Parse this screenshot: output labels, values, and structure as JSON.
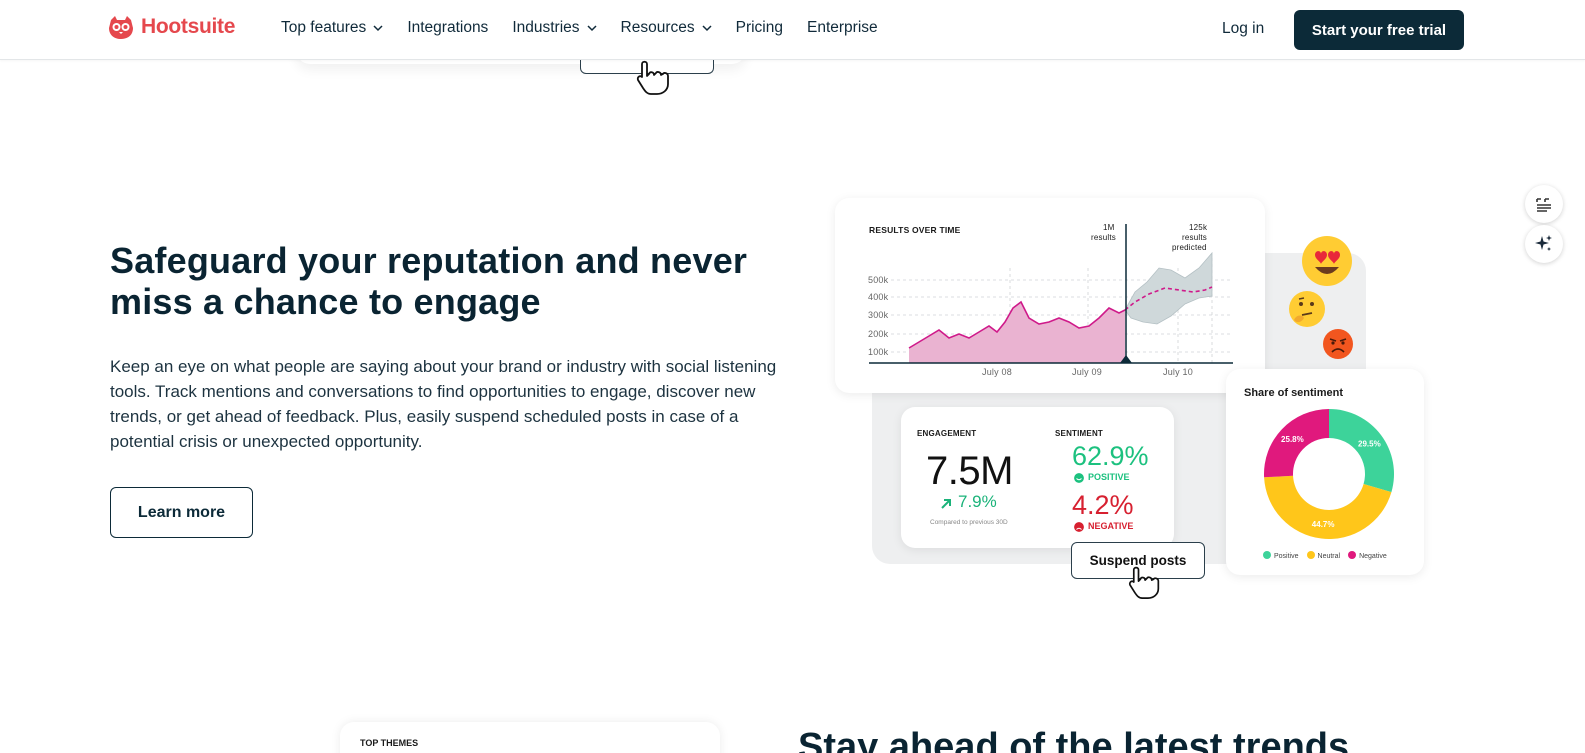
{
  "nav": {
    "logo_text": "Hootsuite",
    "items": [
      {
        "label": "Top features",
        "has_dropdown": true
      },
      {
        "label": "Integrations",
        "has_dropdown": false
      },
      {
        "label": "Industries",
        "has_dropdown": true
      },
      {
        "label": "Resources",
        "has_dropdown": true
      },
      {
        "label": "Pricing",
        "has_dropdown": false
      },
      {
        "label": "Enterprise",
        "has_dropdown": false
      }
    ],
    "login_label": "Log in",
    "cta_label": "Start your free trial"
  },
  "hero": {
    "headline": "Safeguard your reputation and never miss a chance to engage",
    "body": "Keep an eye on what people are saying about your brand or industry with social listening tools. Track mentions and conversations to find opportunities to engage, discover new trends, or get ahead of feedback. Plus, easily suspend scheduled posts in case of a potential crisis or unexpected opportunity.",
    "learn_more_label": "Learn more"
  },
  "results_card": {
    "title": "RESULTS OVER TIME",
    "marker_value": "1M",
    "marker_label": "results",
    "predicted_value": "125k",
    "predicted_label_1": "results",
    "predicted_label_2": "predicted",
    "y_ticks": [
      "500k",
      "400k",
      "300k",
      "200k",
      "100k"
    ],
    "x_ticks": [
      "July 08",
      "July 09",
      "July 10"
    ]
  },
  "engagement_card": {
    "engagement_label": "ENGAGEMENT",
    "engagement_value": "7.5M",
    "engagement_change": "7.9%",
    "engagement_note": "Compared to previous 30D",
    "sentiment_label": "SENTIMENT",
    "positive_value": "62.9%",
    "positive_label": "POSITIVE",
    "negative_value": "4.2%",
    "negative_label": "NEGATIVE"
  },
  "suspend_label": "Suspend posts",
  "sentiment_card": {
    "title": "Share of sentiment",
    "slices": [
      {
        "name": "Positive",
        "value": 29.5,
        "label": "29.5%",
        "color": "#3dd39a"
      },
      {
        "name": "Neutral",
        "value": 44.7,
        "label": "44.7%",
        "color": "#ffc61a"
      },
      {
        "name": "Negative",
        "value": 25.8,
        "label": "25.8%",
        "color": "#e0197d"
      }
    ]
  },
  "colors": {
    "brand": "#e5484d",
    "dark": "#0c2a38",
    "line": "#cf1a8a",
    "area": "#eab3d1"
  },
  "bottom": {
    "card_label": "TOP THEMES",
    "heading": "Stay ahead of the latest trends"
  },
  "side_buttons": [
    "caption-icon",
    "sparkle-icon"
  ]
}
